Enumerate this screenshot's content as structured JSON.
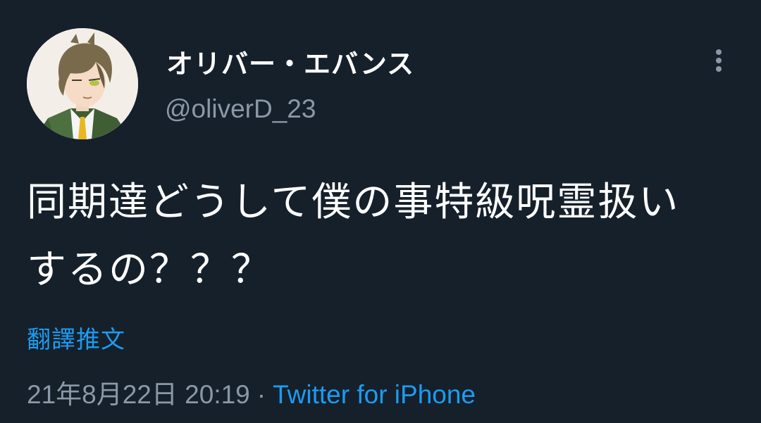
{
  "tweet": {
    "author": {
      "display_name": "オリバー・エバンス",
      "handle": "@oliverD_23",
      "avatar_icon": "anime-character-avatar"
    },
    "more_icon": "more-vertical-icon",
    "text_line1": "同期達どうして僕の事特級呪霊扱い",
    "text_line2": "するの？？？",
    "translate_label": "翻譯推文",
    "timestamp": "21年8月22日 20:19",
    "separator": "·",
    "source": "Twitter for iPhone"
  },
  "colors": {
    "background": "#15202b",
    "primary_text": "#ffffff",
    "secondary_text": "#8b98a5",
    "link": "#1d9bf0"
  }
}
